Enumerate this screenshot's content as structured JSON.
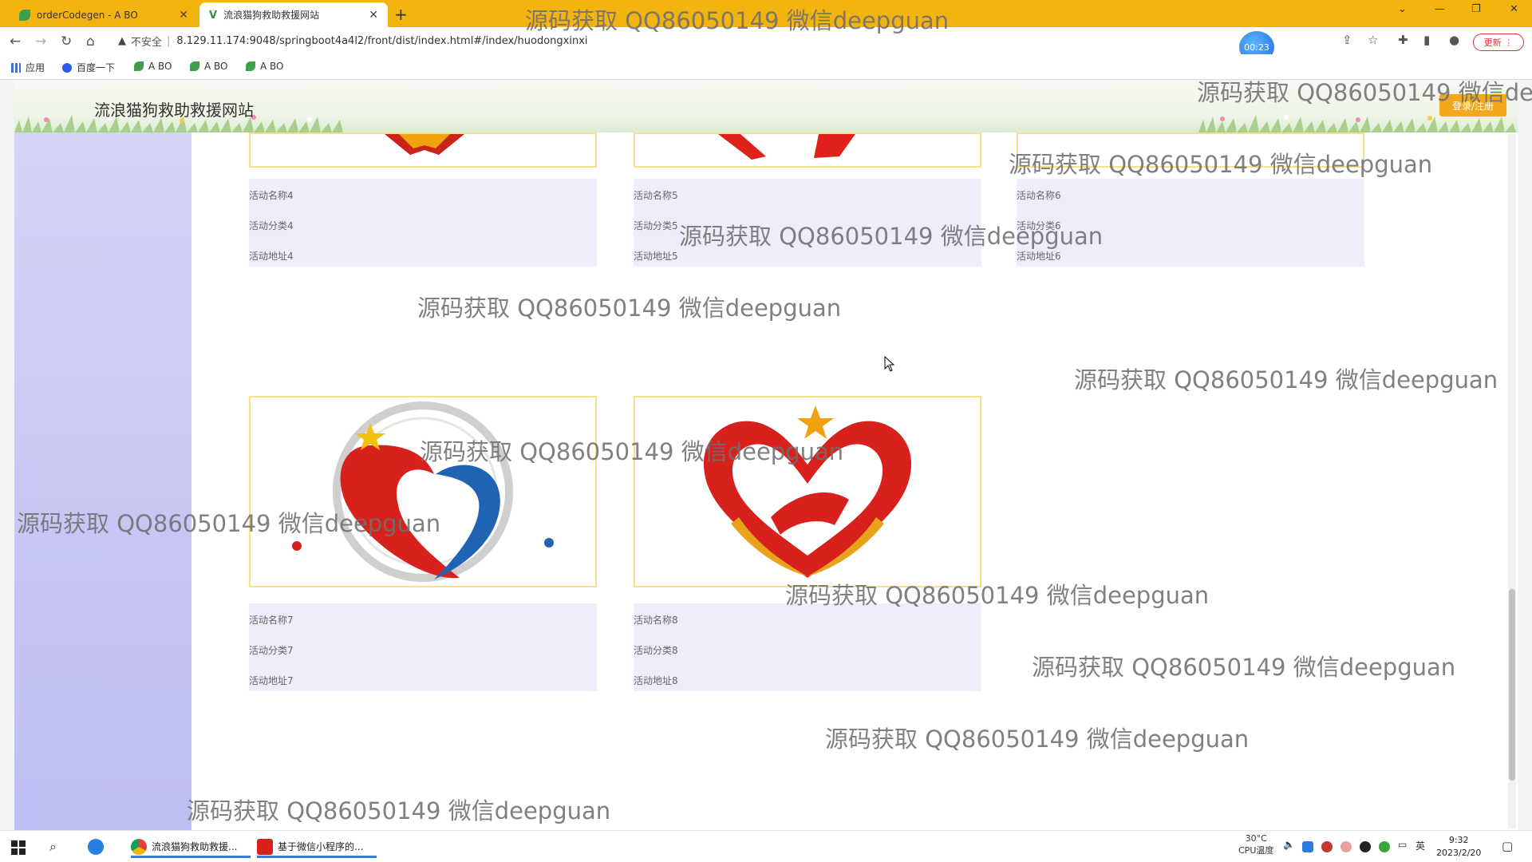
{
  "browser": {
    "tabs": [
      {
        "title": "orderCodegen - A BO",
        "icon": "leaf-icon"
      },
      {
        "title": "流浪猫狗救助救援网站",
        "icon": "v-logo-icon"
      }
    ],
    "address": "8.129.11.174:9048/springboot4a4l2/front/dist/index.html#/index/huodongxinxi",
    "insecure_label": "不安全",
    "timer": "00:23",
    "update_label": "更新",
    "bookmarks": [
      "应用",
      "百度一下",
      "A BO",
      "A BO",
      "A BO"
    ]
  },
  "site": {
    "title": "流浪猫狗救助救援网站",
    "login_label": "登录/注册"
  },
  "activities": [
    {
      "name": "活动名称4",
      "category": "活动分类4",
      "address": "活动地址4"
    },
    {
      "name": "活动名称5",
      "category": "活动分类5",
      "address": "活动地址5"
    },
    {
      "name": "活动名称6",
      "category": "活动分类6",
      "address": "活动地址6"
    },
    {
      "name": "活动名称7",
      "category": "活动分类7",
      "address": "活动地址7"
    },
    {
      "name": "活动名称8",
      "category": "活动分类8",
      "address": "活动地址8"
    }
  ],
  "watermark": "源码获取 QQ86050149 微信deepguan",
  "taskbar": {
    "items": [
      "流浪猫狗救助救援...",
      "基于微信小程序的..."
    ],
    "cpu_temp": "30°C",
    "cpu_label": "CPU温度",
    "ime": "英",
    "time": "9:32",
    "date": "2023/2/20"
  }
}
